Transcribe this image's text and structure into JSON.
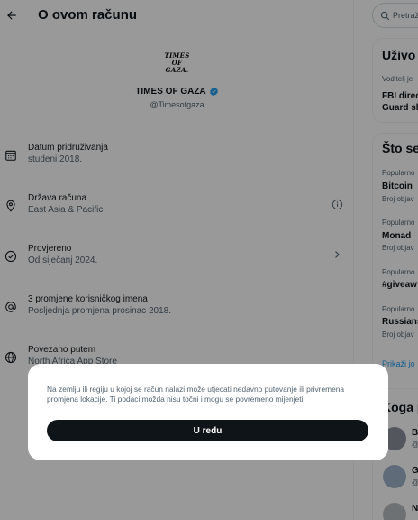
{
  "header": {
    "title": "O ovom računu"
  },
  "profile": {
    "avatar_lines": [
      "TIMES",
      "OF",
      "GAZA."
    ],
    "display_name": "TIMES OF GAZA",
    "handle": "@Timesofgaza"
  },
  "info_rows": [
    {
      "icon": "calendar-icon",
      "label": "Datum pridruživanja",
      "value": "studeni 2018."
    },
    {
      "icon": "location-icon",
      "label": "Država računa",
      "value": "East Asia & Pacific"
    },
    {
      "icon": "verified-check-icon",
      "label": "Provjereno",
      "value": "Od siječanj 2024."
    },
    {
      "icon": "at-icon",
      "label": "3 promjene korisničkog imena",
      "value": "Posljednja promjena prosinac 2018."
    },
    {
      "icon": "globe-icon",
      "label": "Povezano putem",
      "value": "North Africa App Store"
    }
  ],
  "sidebar": {
    "search_placeholder": "Pretraž",
    "live": {
      "title": "Uživo r",
      "meta": "Voditelj je",
      "line1": "FBI direc",
      "line2": "Guard sh"
    },
    "trends": {
      "title": "Što se",
      "items": [
        {
          "meta": "Popularno",
          "title": "Bitcoin",
          "count": "Broj objav"
        },
        {
          "meta": "Popularno",
          "title": "Monad",
          "count": "Broj objav"
        },
        {
          "meta": "Popularno",
          "title": "#giveaw",
          "count": ""
        },
        {
          "meta": "Popularno",
          "title": "Russians",
          "count": "Broj objav"
        }
      ],
      "show_more": "Prikaži jo"
    },
    "who_to_follow": {
      "title": "Koga p",
      "items": [
        {
          "initial": "B",
          "sub": "@"
        },
        {
          "initial": "G",
          "sub": "@"
        },
        {
          "initial": "N",
          "sub": ""
        }
      ]
    }
  },
  "dialog": {
    "text": "Na zemlju ili regiju u kojoj se račun nalazi može utjecati nedavno putovanje ili privremena promjena lokacije. Ti podaci možda nisu točni i mogu se povremeno mijenjeti.",
    "button_label": "U redu"
  },
  "colors": {
    "accent": "#1d9bf0",
    "text_primary": "#0f1419",
    "text_secondary": "#536471",
    "button_bg": "#0f1419"
  }
}
